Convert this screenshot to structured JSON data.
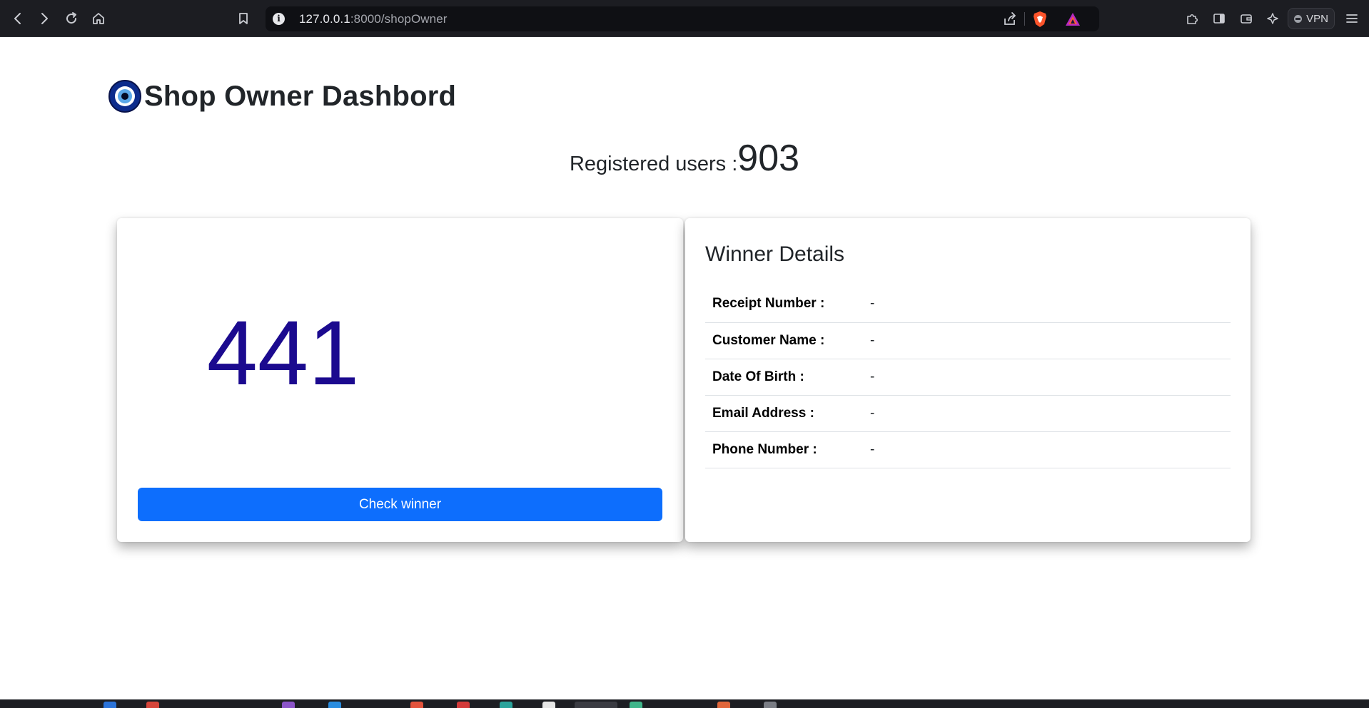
{
  "browser": {
    "url_host": "127.0.0.1",
    "url_path": ":8000/shopOwner",
    "vpn_label": "VPN"
  },
  "page": {
    "title": "Shop Owner Dashbord",
    "registered_label": "Registered users :",
    "registered_count": "903"
  },
  "draw": {
    "number": "441",
    "button_label": "Check winner"
  },
  "winner": {
    "title": "Winner Details",
    "rows": [
      {
        "label": "Receipt Number :",
        "value": "-"
      },
      {
        "label": "Customer Name :",
        "value": "-"
      },
      {
        "label": "Date Of Birth :",
        "value": "-"
      },
      {
        "label": "Email Address :",
        "value": "-"
      },
      {
        "label": "Phone Number :",
        "value": "-"
      }
    ]
  },
  "colors": {
    "primary": "#0d6efd",
    "number": "#1b0a8f",
    "browser_bg": "#1c1d22"
  }
}
